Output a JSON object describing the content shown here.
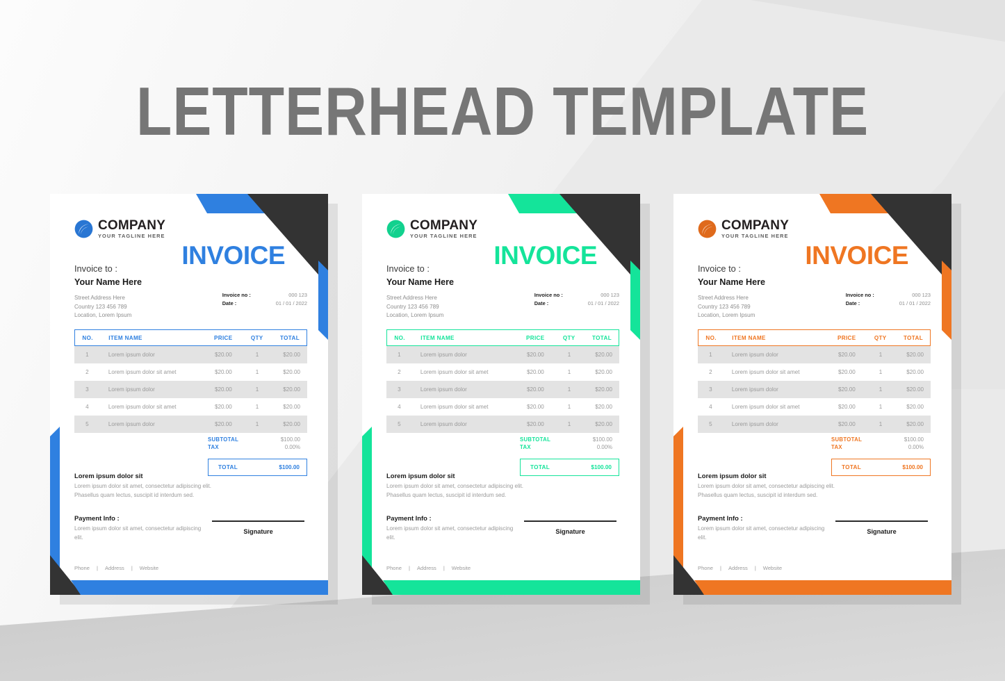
{
  "page": {
    "title": "LETTERHEAD TEMPLATE",
    "background_color": "#ececec",
    "title_color": "#767676"
  },
  "brand": {
    "company": "COMPANY",
    "tagline": "YOUR TAGLINE HERE",
    "logo_icon": "swoosh-circle-logo"
  },
  "labels": {
    "invoice_word": "INVOICE",
    "bill_to": "Invoice to :",
    "client_name": "Your Name Here",
    "address_line1": "Street Address Here",
    "address_line2": "Country 123 456 789",
    "address_line3": "Location, Lorem Ipsum",
    "invoice_no_label": "Invoice no :",
    "invoice_no_value": "000 123",
    "date_label": "Date :",
    "date_value": "01 / 01 / 2022",
    "notes_heading": "Lorem ipsum dolor sit",
    "notes_body": "Lorem ipsum dolor sit amet, consectetur adipiscing elit. Phasellus quam lectus, suscipit id interdum sed.",
    "payment_heading": "Payment Info :",
    "payment_body": "Lorem ipsum dolor sit amet, consectetur adipiscing elit.",
    "signature": "Signature",
    "footer_phone": "Phone",
    "footer_address": "Address",
    "footer_website": "Website",
    "footer_sep": "|"
  },
  "table": {
    "columns": [
      "NO.",
      "ITEM NAME",
      "PRICE",
      "QTY",
      "TOTAL"
    ],
    "rows": [
      {
        "no": "1",
        "item": "Lorem ipsum dolor",
        "price": "$20.00",
        "qty": "1",
        "total": "$20.00"
      },
      {
        "no": "2",
        "item": "Lorem ipsum dolor sit amet",
        "price": "$20.00",
        "qty": "1",
        "total": "$20.00"
      },
      {
        "no": "3",
        "item": "Lorem ipsum dolor",
        "price": "$20.00",
        "qty": "1",
        "total": "$20.00"
      },
      {
        "no": "4",
        "item": "Lorem ipsum dolor sit amet",
        "price": "$20.00",
        "qty": "1",
        "total": "$20.00"
      },
      {
        "no": "5",
        "item": "Lorem ipsum dolor",
        "price": "$20.00",
        "qty": "1",
        "total": "$20.00"
      }
    ]
  },
  "totals": {
    "subtotal_label": "SUBTOTAL",
    "subtotal_value": "$100.00",
    "tax_label": "TAX",
    "tax_value": "0.00%",
    "total_label": "TOTAL",
    "total_value": "$100.00"
  },
  "variants": [
    {
      "name": "blue",
      "accent": "#2f80e0",
      "dark": "#333333"
    },
    {
      "name": "green",
      "accent": "#14e49a",
      "dark": "#333333"
    },
    {
      "name": "orange",
      "accent": "#ef7622",
      "dark": "#333333"
    }
  ]
}
